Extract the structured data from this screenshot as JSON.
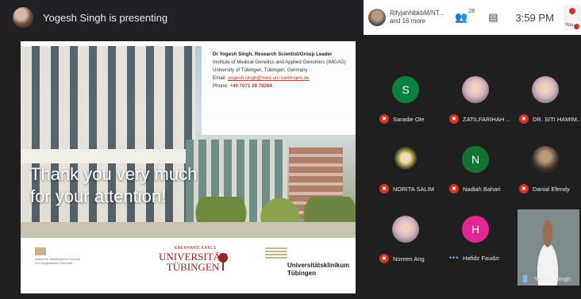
{
  "topbar": {
    "presenting_text": "Yogesh Singh is presenting"
  },
  "rightbar": {
    "people_line1": "RifyjahNbkbM/NT...",
    "people_line2": "and 16 more",
    "participant_count": "28",
    "clock": "3:59 PM",
    "you_label": "You"
  },
  "slide": {
    "thanks_line1": "Thank you very much",
    "thanks_line2": "for your attention!",
    "info": {
      "name": "Dr Yogesh Singh, Research Scientist/Group Leader",
      "institute": "Institute of Medical Genetics and Applied Genomics (IMGAG)",
      "university": "University of Tübingen, Tübingen, Germany",
      "email_prefix": "Email:",
      "email": "yogesh.singh@med.uni-tuebingen.de",
      "phone_prefix": "Phone:",
      "phone": "+49 7071 29 78264"
    },
    "logo_left": "Institut für Medizinische Genetik und Angewandte Genomik",
    "uni_small": "EBERHARD KARLS",
    "uni_line1": "UNIVERSITÄT",
    "uni_line2": "TÜBINGEN",
    "klinik_line1": "Universitätsklinikum",
    "klinik_line2": "Tübingen"
  },
  "participants": [
    {
      "name": "Saradie Ole",
      "initial": "S",
      "color": "#0b8043",
      "avatar": "initial",
      "status": "muted"
    },
    {
      "name": "ZATILFARIHAH ...",
      "initial": "",
      "color": "",
      "avatar": "hijab",
      "status": "muted"
    },
    {
      "name": "DR. SITI HAMIM...",
      "initial": "",
      "color": "",
      "avatar": "hijab",
      "status": "muted"
    },
    {
      "name": "NORITA SALIM",
      "initial": "",
      "color": "",
      "avatar": "yellow",
      "status": "muted"
    },
    {
      "name": "Nadiah Bahari",
      "initial": "N",
      "color": "#137333",
      "avatar": "initial",
      "status": "muted"
    },
    {
      "name": "Danial Efendy",
      "initial": "",
      "color": "",
      "avatar": "dark",
      "status": "muted"
    },
    {
      "name": "Noreen Ang",
      "initial": "",
      "color": "",
      "avatar": "hijab",
      "status": "muted"
    },
    {
      "name": "Hafidz Faudzi",
      "initial": "H",
      "color": "#e52592",
      "avatar": "initial",
      "status": "more"
    }
  ],
  "self_tile": {
    "name": "Yogesh Singh"
  },
  "colors": {
    "mute_red": "#d93025",
    "accent_blue": "#8ab4f8",
    "bg_dark": "#1f1f1f"
  }
}
